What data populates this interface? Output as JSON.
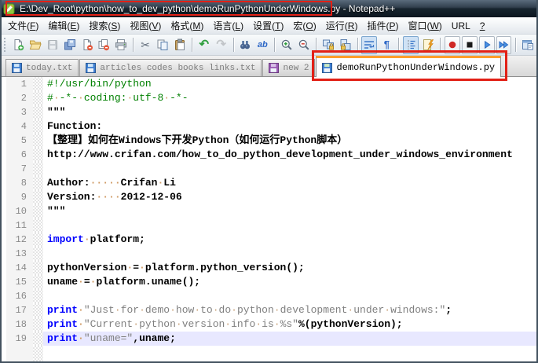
{
  "window": {
    "title": "E:\\Dev_Root\\python\\how_to_dev_python\\demoRunPythonUnderWindows.py - Notepad++",
    "app_icon": "notepad-plus-plus-icon"
  },
  "menu": {
    "items": [
      {
        "id": "file",
        "label": "文件(F)"
      },
      {
        "id": "edit",
        "label": "编辑(E)"
      },
      {
        "id": "search",
        "label": "搜索(S)"
      },
      {
        "id": "view",
        "label": "视图(V)"
      },
      {
        "id": "format",
        "label": "格式(M)"
      },
      {
        "id": "language",
        "label": "语言(L)"
      },
      {
        "id": "settings",
        "label": "设置(T)"
      },
      {
        "id": "macro",
        "label": "宏(O)"
      },
      {
        "id": "run",
        "label": "运行(R)"
      },
      {
        "id": "plugins",
        "label": "插件(P)"
      },
      {
        "id": "window",
        "label": "窗口(W)"
      },
      {
        "id": "url",
        "label": "URL"
      },
      {
        "id": "help",
        "label": "?"
      }
    ]
  },
  "toolbar": {
    "buttons": [
      {
        "name": "new-file"
      },
      {
        "name": "open-file"
      },
      {
        "name": "save",
        "disabled": true
      },
      {
        "name": "save-all"
      },
      {
        "name": "close"
      },
      {
        "name": "close-all"
      },
      {
        "name": "print"
      },
      {
        "sep": true
      },
      {
        "name": "cut"
      },
      {
        "name": "copy"
      },
      {
        "name": "paste"
      },
      {
        "sep": true
      },
      {
        "name": "undo"
      },
      {
        "name": "redo",
        "disabled": true
      },
      {
        "sep": true
      },
      {
        "name": "find"
      },
      {
        "name": "replace"
      },
      {
        "sep": true
      },
      {
        "name": "zoom-in"
      },
      {
        "name": "zoom-out"
      },
      {
        "sep": true
      },
      {
        "name": "sync-vertical-scroll"
      },
      {
        "name": "sync-horizontal-scroll"
      },
      {
        "sep": true
      },
      {
        "name": "word-wrap",
        "pressed": true
      },
      {
        "name": "show-all-characters"
      },
      {
        "sep": true
      },
      {
        "name": "indent-guide",
        "pressed": true
      },
      {
        "name": "function-list"
      },
      {
        "sep": true
      },
      {
        "name": "record-macro",
        "framed": true
      },
      {
        "name": "stop-macro",
        "framed": true
      },
      {
        "name": "play-macro",
        "framed": true
      },
      {
        "name": "run-macro-multiple",
        "framed": true
      },
      {
        "sep": true
      },
      {
        "name": "doc-switcher"
      }
    ]
  },
  "tabs": {
    "items": [
      {
        "id": "today",
        "label": "today.txt",
        "icon": "floppy-saved",
        "active": false
      },
      {
        "id": "articles",
        "label": "articles codes books links.txt",
        "icon": "floppy-saved",
        "active": false
      },
      {
        "id": "new-2",
        "label": "new 2",
        "icon": "floppy-modified",
        "active": false
      },
      {
        "id": "demo",
        "label": "demoRunPythonUnderWindows.py",
        "icon": "floppy-saved",
        "active": true
      }
    ]
  },
  "annotations": {
    "color": "#e22016",
    "boxes": [
      "title-path-highlight",
      "active-tab-highlight"
    ]
  },
  "editor": {
    "language": "Python",
    "current_line": 19,
    "show_whitespace": true,
    "lines": [
      {
        "n": 1,
        "t": [
          [
            "c",
            "#!/usr/bin/python"
          ]
        ]
      },
      {
        "n": 2,
        "t": [
          [
            "c",
            "# -*- coding: utf-8 -*-"
          ]
        ]
      },
      {
        "n": 3,
        "t": [
          [
            "d",
            "\"\"\""
          ]
        ]
      },
      {
        "n": 4,
        "t": [
          [
            "d",
            "Function:"
          ]
        ]
      },
      {
        "n": 5,
        "t": [
          [
            "d",
            "【整理】如何在Windows下开发Python（如何运行Python脚本）"
          ]
        ]
      },
      {
        "n": 6,
        "t": [
          [
            "d",
            "http://www.crifan.com/how_to_do_python_development_under_windows_environment"
          ]
        ]
      },
      {
        "n": 7,
        "t": []
      },
      {
        "n": 8,
        "t": [
          [
            "d",
            "Author:     Crifan Li"
          ]
        ]
      },
      {
        "n": 9,
        "t": [
          [
            "d",
            "Version:    2012-12-06"
          ]
        ]
      },
      {
        "n": 10,
        "t": [
          [
            "d",
            "\"\"\""
          ]
        ]
      },
      {
        "n": 11,
        "t": []
      },
      {
        "n": 12,
        "t": [
          [
            "k",
            "import"
          ],
          [
            "i",
            " platform"
          ],
          [
            "o",
            ";"
          ]
        ]
      },
      {
        "n": 13,
        "t": []
      },
      {
        "n": 14,
        "t": [
          [
            "i",
            "pythonVersion "
          ],
          [
            "o",
            "="
          ],
          [
            "i",
            " platform"
          ],
          [
            "o",
            "."
          ],
          [
            "i",
            "python_version"
          ],
          [
            "o",
            "();"
          ]
        ]
      },
      {
        "n": 15,
        "t": [
          [
            "i",
            "uname "
          ],
          [
            "o",
            "="
          ],
          [
            "i",
            " platform"
          ],
          [
            "o",
            "."
          ],
          [
            "i",
            "uname"
          ],
          [
            "o",
            "();"
          ]
        ]
      },
      {
        "n": 16,
        "t": []
      },
      {
        "n": 17,
        "t": [
          [
            "k",
            "print"
          ],
          [
            "i",
            " "
          ],
          [
            "s",
            "\"Just for demo how to do python development under windows:\""
          ],
          [
            "o",
            ";"
          ]
        ]
      },
      {
        "n": 18,
        "t": [
          [
            "k",
            "print"
          ],
          [
            "i",
            " "
          ],
          [
            "s",
            "\"Current python version info is %s\""
          ],
          [
            "o",
            "%("
          ],
          [
            "i",
            "pythonVersion"
          ],
          [
            "o",
            ");"
          ]
        ]
      },
      {
        "n": 19,
        "t": [
          [
            "k",
            "print"
          ],
          [
            "i",
            " "
          ],
          [
            "s",
            "\"uname=\""
          ],
          [
            "o",
            ","
          ],
          [
            "i",
            "uname"
          ],
          [
            "o",
            ";"
          ]
        ]
      }
    ],
    "colors": {
      "comment": "#008000",
      "keyword": "#0000ff",
      "string": "#808080",
      "docstring": "#000000",
      "operator": "#000000",
      "plain": "#000000",
      "line_number": "#8a8a8a",
      "current_line_bg": "#e8e8ff",
      "active_tab_accent": "#ff9e2c",
      "annotation": "#e22016"
    }
  }
}
